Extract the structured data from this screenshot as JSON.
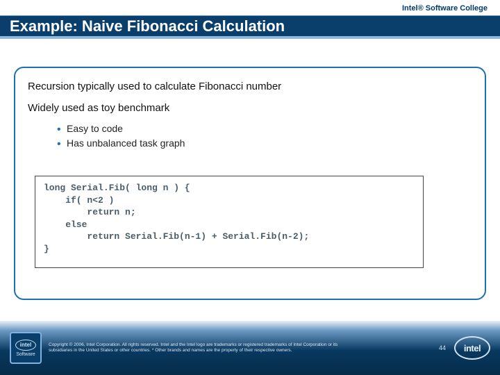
{
  "header": {
    "brand": "Intel® Software College",
    "title": "Example: Naive Fibonacci Calculation"
  },
  "content": {
    "lead1": "Recursion typically used to calculate Fibonacci number",
    "lead2": "Widely used as toy benchmark",
    "bullets": [
      "Easy to code",
      "Has unbalanced task graph"
    ],
    "code": "long Serial.Fib( long n ) {\n    if( n<2 )\n        return n;\n    else\n        return Serial.Fib(n-1) + Serial.Fib(n-2);\n}"
  },
  "footer": {
    "badge_top": "intel",
    "badge_bottom": "Software",
    "copyright": "Copyright © 2006, Intel Corporation. All rights reserved.\nIntel and the Intel logo are trademarks or registered trademarks of Intel Corporation or its subsidiaries in the United States or other countries. * Other brands and names are the property of their respective owners.",
    "page": "44",
    "logo": "intel"
  }
}
